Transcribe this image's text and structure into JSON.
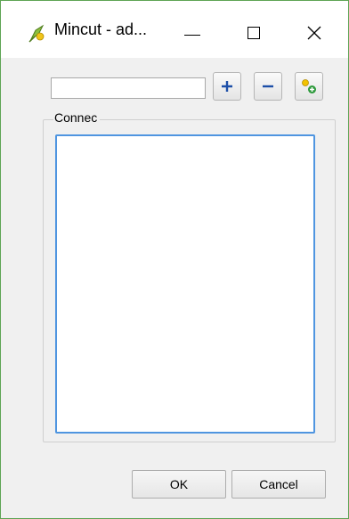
{
  "window": {
    "title": "Mincut - ad...",
    "app_icon": "qgis-icon",
    "controls": {
      "minimize": "minimize-icon",
      "maximize": "maximize-icon",
      "close": "close-icon"
    }
  },
  "toolbar": {
    "name_input": {
      "value": "",
      "placeholder": ""
    },
    "add_button": {
      "icon": "plus-icon"
    },
    "remove_button": {
      "icon": "minus-icon"
    },
    "select_button": {
      "icon": "select-feature-icon"
    }
  },
  "group": {
    "title": "Connec",
    "items": []
  },
  "footer": {
    "ok_label": "OK",
    "cancel_label": "Cancel"
  },
  "colors": {
    "add_icon": "#1d4fa8",
    "remove_icon": "#1d4fa8",
    "focus_border": "#4f95e0",
    "window_border": "#5ea454"
  }
}
